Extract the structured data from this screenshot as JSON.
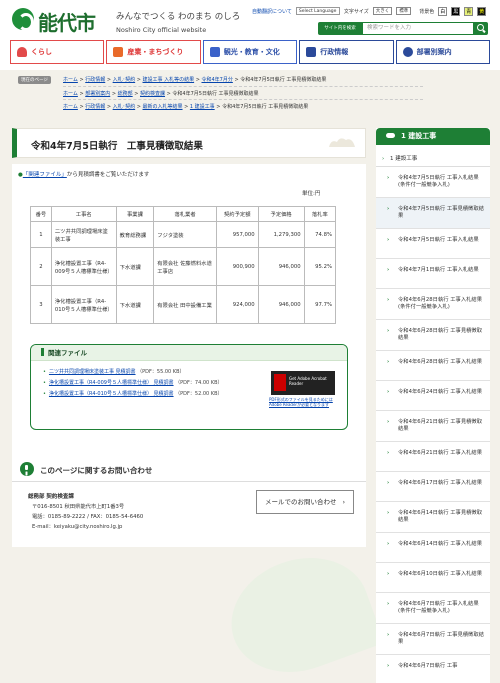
{
  "header": {
    "logo_text": "能代市",
    "tagline": "みんなでつくる わのまち のしろ",
    "tagline_en": "Noshiro City official website",
    "auto_translate_link": "自動翻訳について",
    "language_select": "Select Language",
    "text_size_label": "文字サイズ",
    "text_size_large": "大きく",
    "text_size_normal": "標準",
    "bg_color_label": "背景色",
    "bg_colors": [
      "白",
      "黒",
      "青",
      "黄"
    ],
    "search_label": "サイト内を検索",
    "search_placeholder": "検索ワードを入力"
  },
  "gnav": [
    "くらし",
    "産業・まちづくり",
    "観光・教育・文化",
    "行政情報",
    "部署別案内"
  ],
  "breadcrumb": {
    "here_label": "現在のページ",
    "line1": [
      "ホーム",
      "行政情報",
      "入札･契約",
      "建設工事 入札等の結果",
      "令和4年7月分"
    ],
    "line1_current": "令和4年7月5日執行 工事見積徴取結果",
    "line2": [
      "ホーム",
      "部署別案内",
      "総務部",
      "契約検査課"
    ],
    "line2_current": "令和4年7月5日執行 工事見積徴取結果",
    "line3": [
      "ホーム",
      "行政情報",
      "入札･契約",
      "最新の入札等結果",
      "1 建設工事"
    ],
    "line3_current": "令和4年7月5日執行 工事見積徴取結果",
    "sep": " > "
  },
  "page": {
    "title": "令和4年7月5日執行　工事見積徴取結果",
    "intro_link": "「関連ファイル」",
    "intro_text": "から見積調書をご覧いただけます",
    "unit": "単位:円"
  },
  "table": {
    "headers": [
      "番号",
      "工事名",
      "事業課",
      "落札業者",
      "契約予定額",
      "予定価格",
      "落札率"
    ],
    "rows": [
      [
        "1",
        "二ツ井共同調理場床塗装工事",
        "教育総務課",
        "フジタ塗装",
        "957,000",
        "1,279,300",
        "74.8%"
      ],
      [
        "2",
        "浄化槽設置工事（R4-009号５人槽標準仕様）",
        "下水道課",
        "有限会社 佐藤燃料水道工事店",
        "900,900",
        "946,000",
        "95.2%"
      ],
      [
        "3",
        "浄化槽設置工事（R4-010号５人槽標準仕様）",
        "下水道課",
        "有限会社 田中設備工業",
        "924,000",
        "946,000",
        "97.7%"
      ]
    ]
  },
  "related": {
    "title": "関連ファイル",
    "files": [
      {
        "name": "二ツ井共同調理場床塗装工事 見積調書",
        "size": "（PDF：55.00 KB）"
      },
      {
        "name": "浄化槽設置工事（R4-009号５人槽標準仕様） 見積調書",
        "size": "（PDF：74.00 KB）"
      },
      {
        "name": "浄化槽設置工事（R4-010号５人槽標準仕様） 見積調書",
        "size": "（PDF：52.00 KB）"
      }
    ],
    "adobe_text": "Get Adobe Acrobat Reader",
    "adobe_note": "PDF形式のファイルを見るためにはAdobe Readerが必要となります"
  },
  "contact": {
    "title": "このページに関するお問い合わせ",
    "dept": "総務部 契約検査課",
    "address": "〒016-8501 秋田県能代市上町1番3号",
    "phone": "電話：0185-89-2222 / FAX：0185-54-6460",
    "email": "E-mail：keiyaku@city.noshiro.lg.jp",
    "button": "メールでのお問い合わせ"
  },
  "sidebar": {
    "heading": "1 建設工事",
    "sub": "1 建設工事",
    "items": [
      "令和4年7月5日執行 工事入札結果(条件付一般競争入札)",
      "令和4年7月5日執行 工事見積徴取結果",
      "令和4年7月5日執行 工事入札結果",
      "令和4年7月1日執行 工事入札結果",
      "令和4年6月28日執行 工事入札結果(条件付一般競争入札)",
      "令和4年6月28日執行 工事見積徴取結果",
      "令和4年6月28日執行 工事入札結果",
      "令和4年6月24日執行 工事入札結果",
      "令和4年6月21日執行 工事見積徴取結果",
      "令和4年6月21日執行 工事入札結果",
      "令和4年6月17日執行 工事入札結果",
      "令和4年6月14日執行 工事見積徴取結果",
      "令和4年6月14日執行 工事入札結果",
      "令和4年6月10日執行 工事入札結果",
      "令和4年6月7日執行 工事入札結果(条件付一般競争入札)",
      "令和4年6月7日執行 工事見積徴取結果",
      "令和4年6月7日執行 工事"
    ]
  }
}
